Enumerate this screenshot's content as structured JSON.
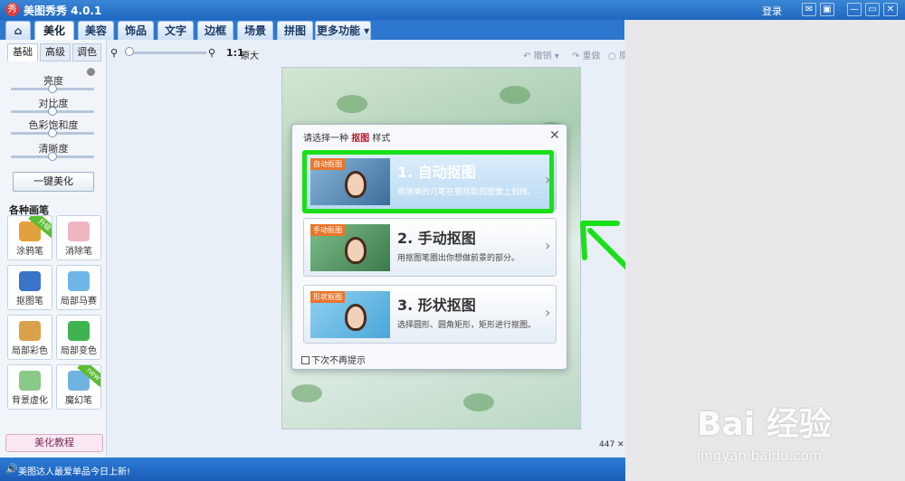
{
  "app": {
    "title": "美图秀秀 4.0.1",
    "logo_glyph": "秀"
  },
  "titlebar": {
    "login": "登录",
    "buttons": [
      "✉",
      "▣",
      "—",
      "▭",
      "✕"
    ]
  },
  "main_tabs": [
    {
      "label": "⌂",
      "name": "home"
    },
    {
      "label": "美化",
      "active": true
    },
    {
      "label": "美容"
    },
    {
      "label": "饰品"
    },
    {
      "label": "文字"
    },
    {
      "label": "边框"
    },
    {
      "label": "场景"
    },
    {
      "label": "拼图"
    },
    {
      "label": "更多功能 ▾"
    }
  ],
  "left_panel": {
    "subtabs": [
      "基础",
      "高级",
      "调色"
    ],
    "sliders": [
      "亮度",
      "对比度",
      "色彩饱和度",
      "清晰度"
    ],
    "one_click": "一键美化",
    "brush_heading": "各种画笔",
    "tools": [
      {
        "label": "涂鸦笔",
        "badge": "升级",
        "color": "#e2a13c"
      },
      {
        "label": "消除笔",
        "color": "#f0b6c2"
      },
      {
        "label": "抠图笔",
        "color": "#3a74c8"
      },
      {
        "label": "局部马赛克",
        "color": "#6fb6e8"
      },
      {
        "label": "局部彩色笔",
        "color": "#d9a24a"
      },
      {
        "label": "局部变色笔",
        "color": "#3fb34f"
      },
      {
        "label": "背景虚化",
        "color": "#8bc98a"
      },
      {
        "label": "魔幻笔",
        "badge": "new",
        "color": "#6fb4e0"
      }
    ],
    "tutorial": "美化教程"
  },
  "toolbar": {
    "ratio": "1:1",
    "original": "原大",
    "undo": "撤销",
    "redo": "重做",
    "reset": "原"
  },
  "dialog": {
    "prompt_prefix": "请选择一种",
    "prompt_key": "抠图",
    "prompt_suffix": "样式",
    "options": [
      {
        "tag": "自动抠图",
        "title": "1. 自动抠图",
        "desc": "用简单的几笔在要抠取的图像上划线。"
      },
      {
        "tag": "手动抠图",
        "title": "2. 手动抠图",
        "desc": "用抠图笔圈出你想做前景的部分。"
      },
      {
        "tag": "形状抠图",
        "title": "3. 形状抠图",
        "desc": "选择圆形、圆角矩形，矩形进行抠图。"
      }
    ],
    "dont_show": "下次不再提示"
  },
  "canvas": {
    "size": "447 ✕"
  },
  "statusbar": {
    "speaker": "🔊",
    "message": "美图达人最爱单品今日上新!"
  },
  "watermark": {
    "brand": "Bai 经验",
    "url": "jingyan.baidu.com"
  },
  "colors": {
    "highlight": "#19e019",
    "titlebar": "#1f67c0"
  }
}
